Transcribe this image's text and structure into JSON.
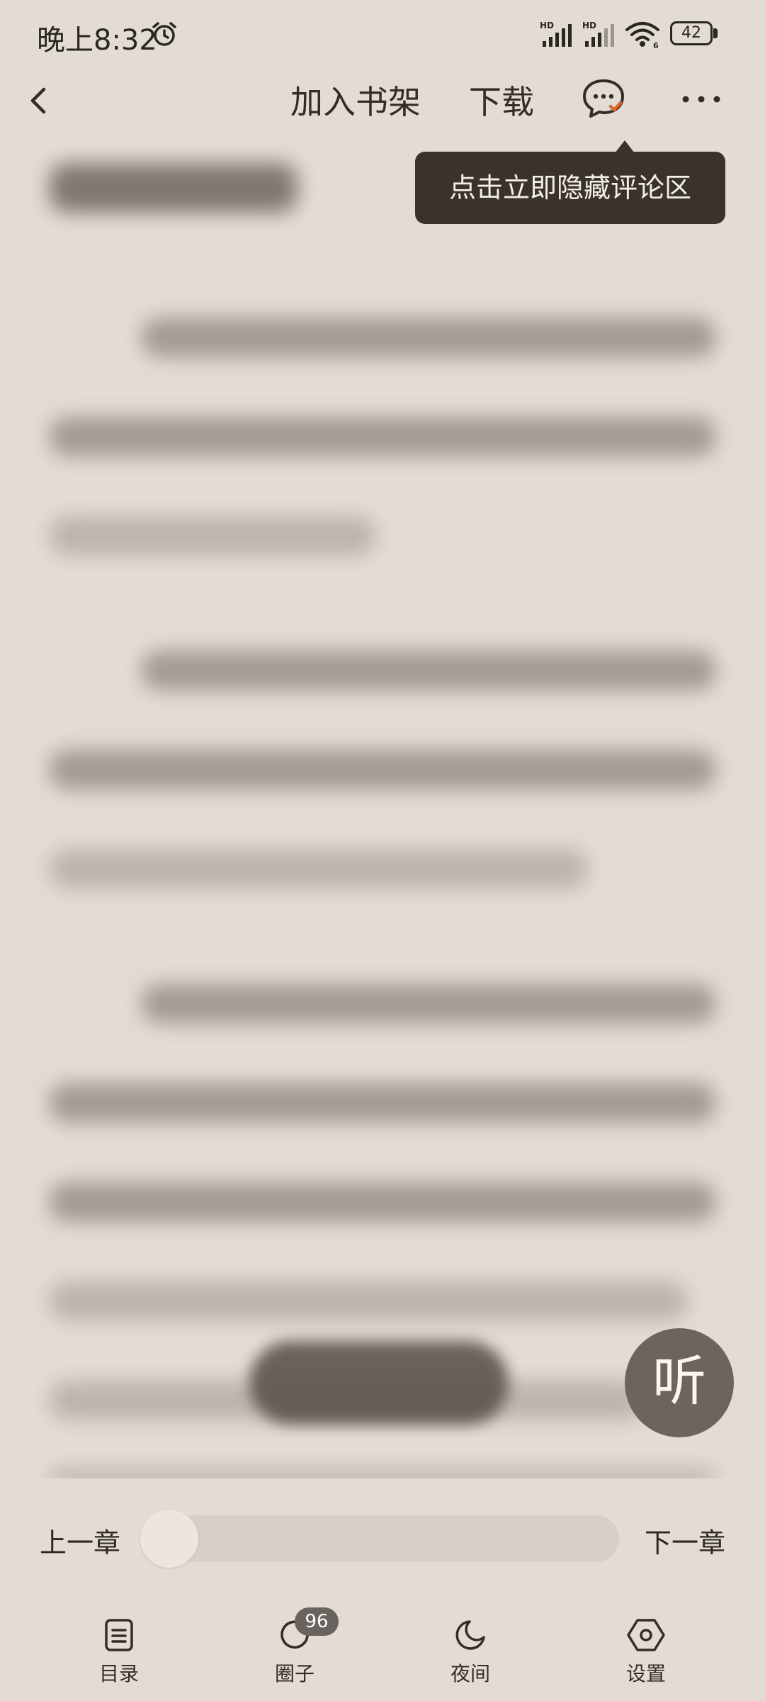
{
  "status_bar": {
    "time": "晚上8:32",
    "signal1_label": "HD",
    "signal2_label": "HD",
    "wifi_label": "6",
    "battery": "42"
  },
  "top_bar": {
    "add_to_shelf": "加入书架",
    "download": "下载"
  },
  "tooltip": {
    "text": "点击立即隐藏评论区"
  },
  "listen_button": {
    "label": "听"
  },
  "chapter_nav": {
    "prev": "上一章",
    "next": "下一章",
    "progress": 0.0
  },
  "bottom_nav": {
    "items": [
      {
        "label": "目录",
        "icon": "catalog-icon"
      },
      {
        "label": "圈子",
        "icon": "circle-icon",
        "badge": "96"
      },
      {
        "label": "夜间",
        "icon": "moon-icon"
      },
      {
        "label": "设置",
        "icon": "settings-icon"
      }
    ]
  },
  "colors": {
    "background": "#e3dcd5",
    "tooltip_bg": "#3a322c",
    "listen_bg": "#6f645c",
    "badge_bg": "#6a625c",
    "comment_check": "#e2622b"
  }
}
